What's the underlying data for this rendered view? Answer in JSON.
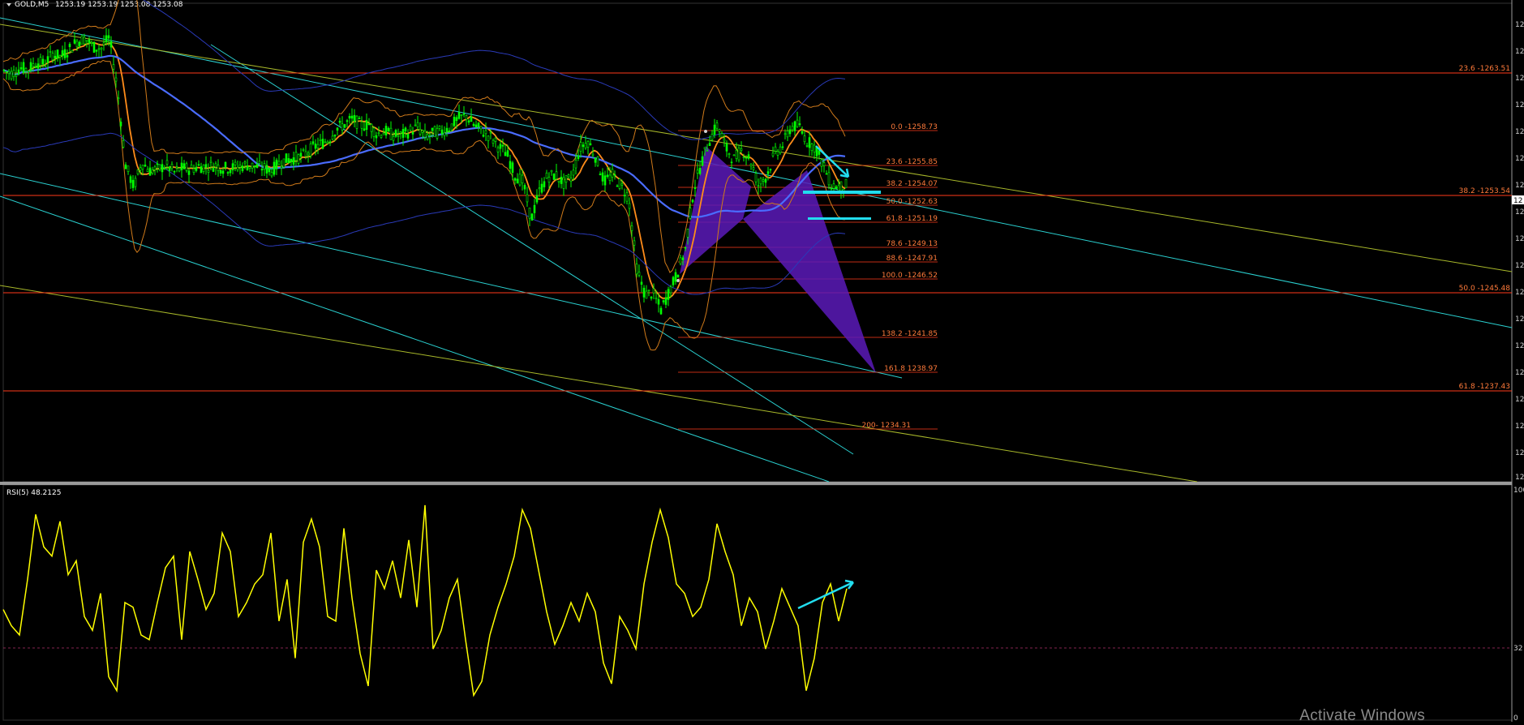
{
  "header": {
    "symbol_label": "GOLD,M5",
    "ohlc_label": "1253.19 1253.19 1253.08 1253.08"
  },
  "indicator": {
    "label": "RSI(5) 48.2125",
    "levels": [
      "100",
      "32",
      "0"
    ]
  },
  "price_scale": {
    "tick_label": "12",
    "current_price_tag": "12"
  },
  "fib_major": [
    {
      "label": "23.6 -1263.51"
    },
    {
      "label": "38.2 -1253.54"
    },
    {
      "label": "50.0 -1245.48"
    },
    {
      "label": "61.8 -1237.43"
    }
  ],
  "fib_minor": [
    {
      "label": "0.0 -1258.73"
    },
    {
      "label": "23.6 -1255.85"
    },
    {
      "label": "38.2 -1254.07"
    },
    {
      "label": "50.0 -1252.63"
    },
    {
      "label": "61.8 -1251.19"
    },
    {
      "label": "78.6 -1249.13"
    },
    {
      "label": "88.6 -1247.91"
    },
    {
      "label": "100.0 -1246.52"
    },
    {
      "label": "138.2 -1241.85"
    },
    {
      "label": "161.8 1238.97"
    },
    {
      "label": "200- 1234.31"
    }
  ],
  "colors": {
    "background": "#000000",
    "candles": "#00ff00",
    "fib_lines": "#ff3a1a",
    "fib_text": "#ff7a3a",
    "ma_slow": "#4a6cff",
    "ma_fast": "#ff8c1a",
    "channel": "#2ad0d0",
    "trend_yellow": "#a8b82a",
    "harmonic_fill": "#5a1ab8",
    "rsi_line": "#ffff00",
    "annotation": "#22ddee"
  },
  "watermark": "Activate Windows",
  "chart_data": {
    "type": "line",
    "xlabel": "",
    "ylabel": "",
    "price_ylim": [
      1232,
      1266
    ],
    "rsi_ylim": [
      0,
      100
    ],
    "rsi_level": 32,
    "fib_major_levels": [
      1263.51,
      1253.54,
      1245.48,
      1237.43
    ],
    "fib_minor_levels": [
      1258.73,
      1255.85,
      1254.07,
      1252.63,
      1251.19,
      1249.13,
      1247.91,
      1246.52,
      1241.85,
      1238.97,
      1234.31
    ],
    "price_series": {
      "x": [
        0,
        10,
        20,
        30,
        40,
        50,
        60,
        70,
        80,
        90,
        100,
        110,
        120,
        130,
        140,
        150,
        160,
        170,
        180,
        190,
        200,
        210,
        220,
        230,
        240,
        250,
        260,
        270,
        280,
        290,
        300,
        310,
        320,
        330,
        340,
        350,
        360,
        370,
        380,
        390,
        400,
        410,
        420,
        430,
        440,
        450,
        460,
        470,
        480,
        490,
        500,
        510,
        520,
        530,
        540,
        550,
        560,
        570,
        580,
        590,
        600,
        610,
        620,
        630,
        640,
        650,
        660,
        670,
        680,
        690,
        700,
        710,
        720,
        730,
        740,
        750,
        760,
        770,
        780,
        790,
        800,
        810,
        820,
        830,
        840,
        850,
        860,
        870,
        880,
        890,
        900,
        910,
        920,
        930,
        940,
        950,
        960,
        970,
        980,
        990,
        1000,
        1010,
        1020,
        1030,
        1040
      ],
      "values": [
        1261.2,
        1261.0,
        1261.4,
        1261.3,
        1261.8,
        1261.7,
        1262.4,
        1262.2,
        1262.7,
        1263.3,
        1263.5,
        1262.9,
        1262.8,
        1263.6,
        1259.8,
        1254.5,
        1252.9,
        1254.7,
        1254.1,
        1254.2,
        1254.5,
        1254.0,
        1254.3,
        1254.2,
        1254.4,
        1254.4,
        1254.5,
        1254.3,
        1254.3,
        1254.4,
        1254.5,
        1254.4,
        1254.3,
        1254.1,
        1254.7,
        1254.9,
        1255.0,
        1255.2,
        1255.7,
        1256.0,
        1256.3,
        1257.1,
        1257.4,
        1257.8,
        1257.3,
        1257.4,
        1256.7,
        1256.9,
        1256.6,
        1256.6,
        1256.9,
        1257.2,
        1256.5,
        1256.8,
        1256.9,
        1257.2,
        1257.8,
        1258.0,
        1257.3,
        1256.9,
        1256.5,
        1255.8,
        1255.3,
        1253.8,
        1253.3,
        1250.6,
        1252.6,
        1253.7,
        1253.8,
        1253.2,
        1253.6,
        1255.7,
        1256.2,
        1255.0,
        1253.3,
        1253.8,
        1253.1,
        1252.2,
        1247.2,
        1245.3,
        1245.4,
        1244.2,
        1245.5,
        1246.8,
        1248.5,
        1252.7,
        1254.7,
        1256.3,
        1257.4,
        1255.7,
        1254.9,
        1255.6,
        1254.9,
        1253.1,
        1253.7,
        1255.3,
        1255.9,
        1257.2,
        1257.3,
        1256.2,
        1255.8,
        1254.5,
        1253.1,
        1252.9,
        1253.1
      ]
    },
    "rsi_series": {
      "x": [
        0,
        10,
        20,
        30,
        40,
        50,
        60,
        70,
        80,
        90,
        100,
        110,
        120,
        130,
        140,
        150,
        160,
        170,
        180,
        190,
        200,
        210,
        220,
        230,
        240,
        250,
        260,
        270,
        280,
        290,
        300,
        310,
        320,
        330,
        340,
        350,
        360,
        370,
        380,
        390,
        400,
        410,
        420,
        430,
        440,
        450,
        460,
        470,
        480,
        490,
        500,
        510,
        520,
        530,
        540,
        550,
        560,
        570,
        580,
        590,
        600,
        610,
        620,
        630,
        640,
        650,
        660,
        670,
        680,
        690,
        700,
        710,
        720,
        730,
        740,
        750,
        760,
        770,
        780,
        790,
        800,
        810,
        820,
        830,
        840,
        850,
        860,
        870,
        880,
        890,
        900,
        910,
        920,
        930,
        940,
        950,
        960,
        970,
        980,
        990,
        1000,
        1010,
        1020,
        1030,
        1040
      ],
      "values": [
        47,
        40,
        36,
        60,
        88,
        74,
        70,
        85,
        62,
        68,
        44,
        38,
        54,
        18,
        12,
        50,
        48,
        36,
        34,
        50,
        65,
        70,
        34,
        72,
        60,
        47,
        54,
        80,
        72,
        44,
        50,
        58,
        62,
        80,
        42,
        60,
        26,
        76,
        86,
        74,
        44,
        42,
        82,
        52,
        28,
        14,
        64,
        56,
        68,
        52,
        77,
        48,
        92,
        30,
        38,
        52,
        60,
        34,
        10,
        16,
        36,
        48,
        58,
        70,
        90,
        82,
        64,
        46,
        32,
        40,
        50,
        42,
        54,
        46,
        24,
        15,
        44,
        38,
        30,
        58,
        76,
        90,
        78,
        58,
        54,
        44,
        48,
        60,
        84,
        72,
        62,
        40,
        52,
        46,
        30,
        42,
        56,
        48,
        40,
        12,
        26,
        50,
        58,
        42,
        56
      ]
    }
  }
}
